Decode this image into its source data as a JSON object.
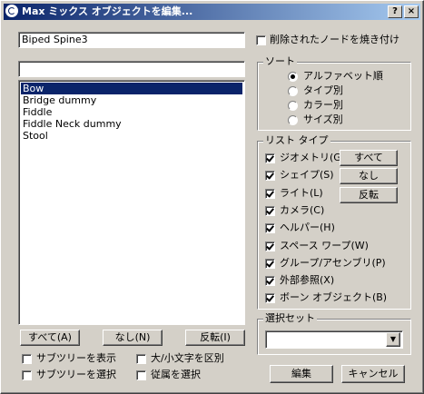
{
  "window": {
    "title": "Max ミックス オブジェクトを編集...",
    "help_button": "?",
    "close_button": "×"
  },
  "name_field": {
    "value": "Biped Spine3"
  },
  "filter_field": {
    "value": ""
  },
  "object_list": {
    "items": [
      {
        "label": "Bow",
        "selected": true
      },
      {
        "label": "Bridge dummy"
      },
      {
        "label": "Fiddle"
      },
      {
        "label": "Fiddle Neck dummy"
      },
      {
        "label": "Stool"
      }
    ]
  },
  "bake_deleted": {
    "label": "削除されたノードを焼き付け",
    "checked": false
  },
  "sort": {
    "title": "ソート",
    "options": [
      {
        "label": "アルファベット順",
        "selected": true
      },
      {
        "label": "タイプ別"
      },
      {
        "label": "カラー別"
      },
      {
        "label": "サイズ別"
      }
    ]
  },
  "list_types": {
    "title": "リスト タイプ",
    "items": [
      {
        "label": "ジオメトリ(G)",
        "checked": true
      },
      {
        "label": "シェイプ(S)",
        "checked": true
      },
      {
        "label": "ライト(L)",
        "checked": true
      },
      {
        "label": "カメラ(C)",
        "checked": true
      },
      {
        "label": "ヘルパー(H)",
        "checked": true
      },
      {
        "label": "スペース ワープ(W)",
        "checked": true
      },
      {
        "label": "グループ/アセンブリ(P)",
        "checked": true
      },
      {
        "label": "外部参照(X)",
        "checked": true
      },
      {
        "label": "ボーン オブジェクト(B)",
        "checked": true
      }
    ],
    "all_button": "すべて",
    "none_button": "なし",
    "invert_button": "反転"
  },
  "selection_set": {
    "title": "選択セット",
    "value": ""
  },
  "list_buttons": {
    "all": "すべて(A)",
    "none": "なし(N)",
    "invert": "反転(I)"
  },
  "options": {
    "show_subtree": {
      "label": "サブツリーを表示",
      "checked": false
    },
    "case_sensitive": {
      "label": "大/小文字を区別",
      "checked": false
    },
    "select_subtree": {
      "label": "サブツリーを選択",
      "checked": false
    },
    "select_dependents": {
      "label": "従属を選択",
      "checked": false
    }
  },
  "footer": {
    "edit_button": "編集",
    "cancel_button": "キャンセル"
  },
  "colors": {
    "title_start": "#0a246a",
    "title_end": "#a6caf0",
    "face": "#d4d0c8",
    "selection": "#0a246a"
  }
}
